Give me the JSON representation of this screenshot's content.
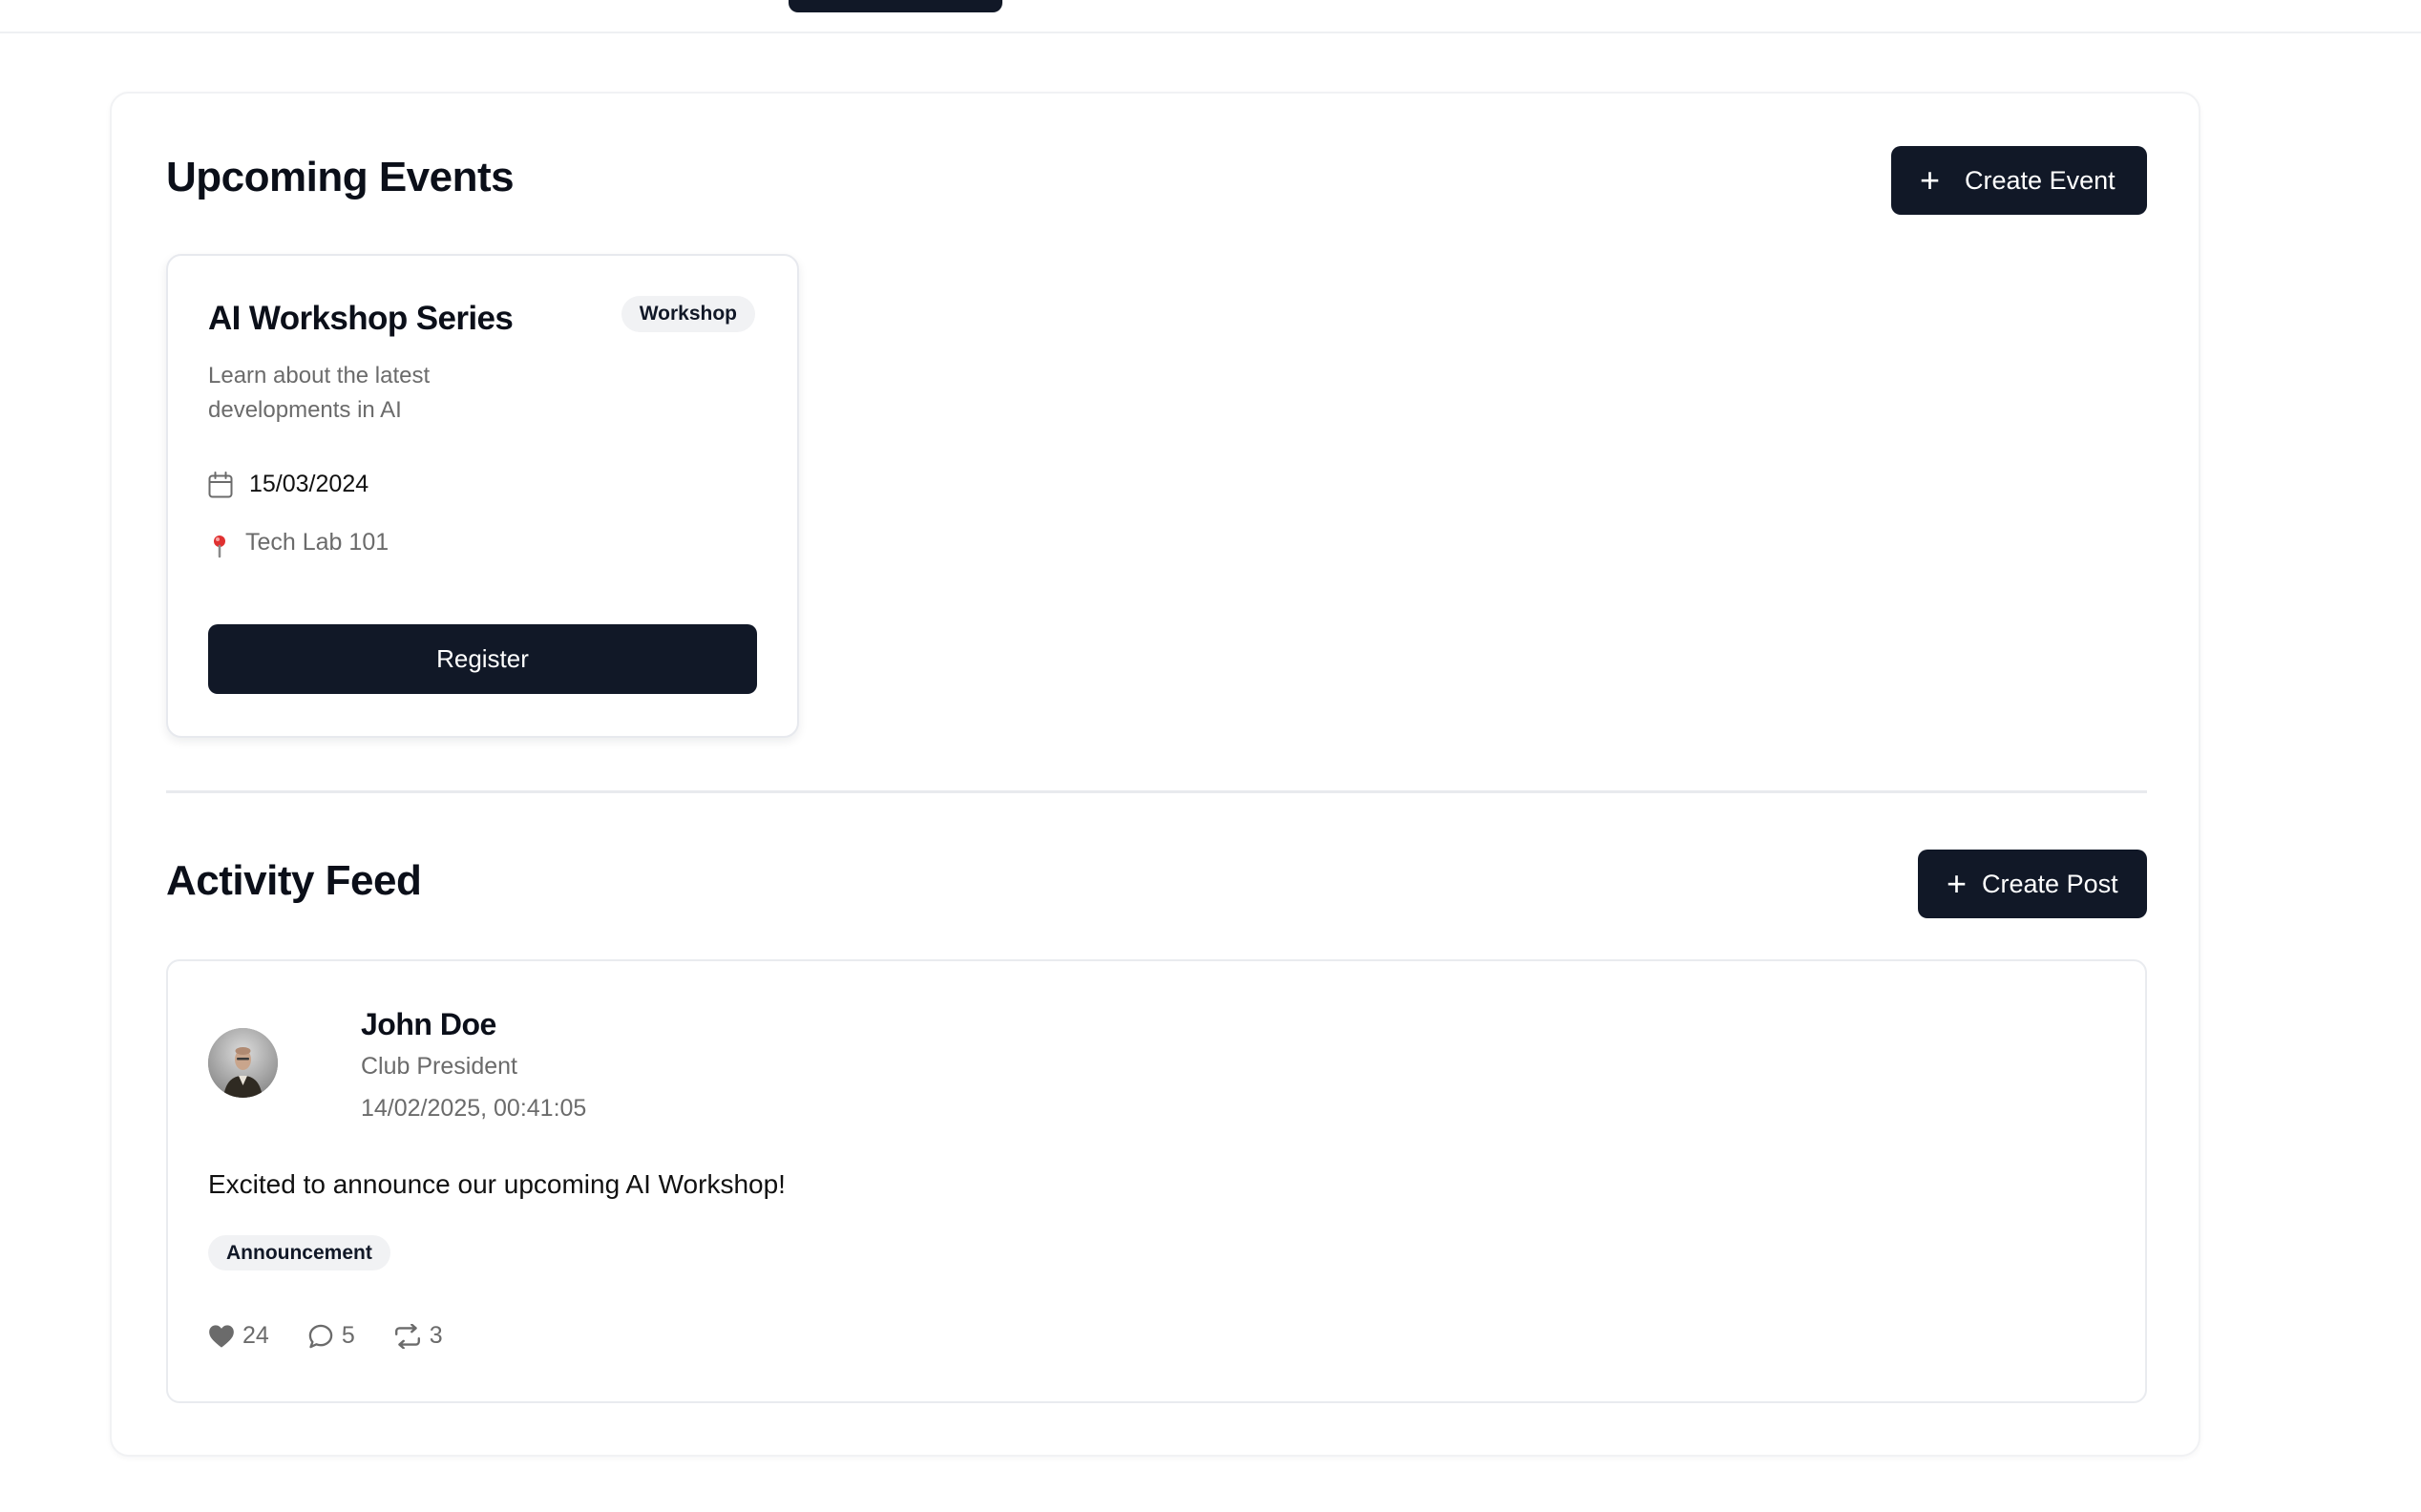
{
  "events": {
    "title": "Upcoming Events",
    "create_label": "Create Event",
    "items": [
      {
        "title": "AI Workshop Series",
        "badge": "Workshop",
        "description": "Learn about the latest developments in AI",
        "date": "15/03/2024",
        "location": "Tech Lab 101",
        "register_label": "Register"
      }
    ]
  },
  "feed": {
    "title": "Activity Feed",
    "create_label": "Create Post",
    "posts": [
      {
        "author": "John Doe",
        "role": "Club President",
        "timestamp": "14/02/2025, 00:41:05",
        "content": "Excited to announce our upcoming AI Workshop!",
        "tag": "Announcement",
        "likes": "24",
        "comments": "5",
        "reposts": "3"
      }
    ]
  },
  "colors": {
    "primary": "#111827",
    "muted_text": "#6b6b6b",
    "badge_bg": "#f1f2f4",
    "pin": "#e03131"
  },
  "icons": {
    "create": "plus-icon",
    "date": "calendar-icon",
    "location": "map-pin-icon",
    "like": "heart-icon",
    "comment": "comment-icon",
    "repost": "repost-icon"
  }
}
